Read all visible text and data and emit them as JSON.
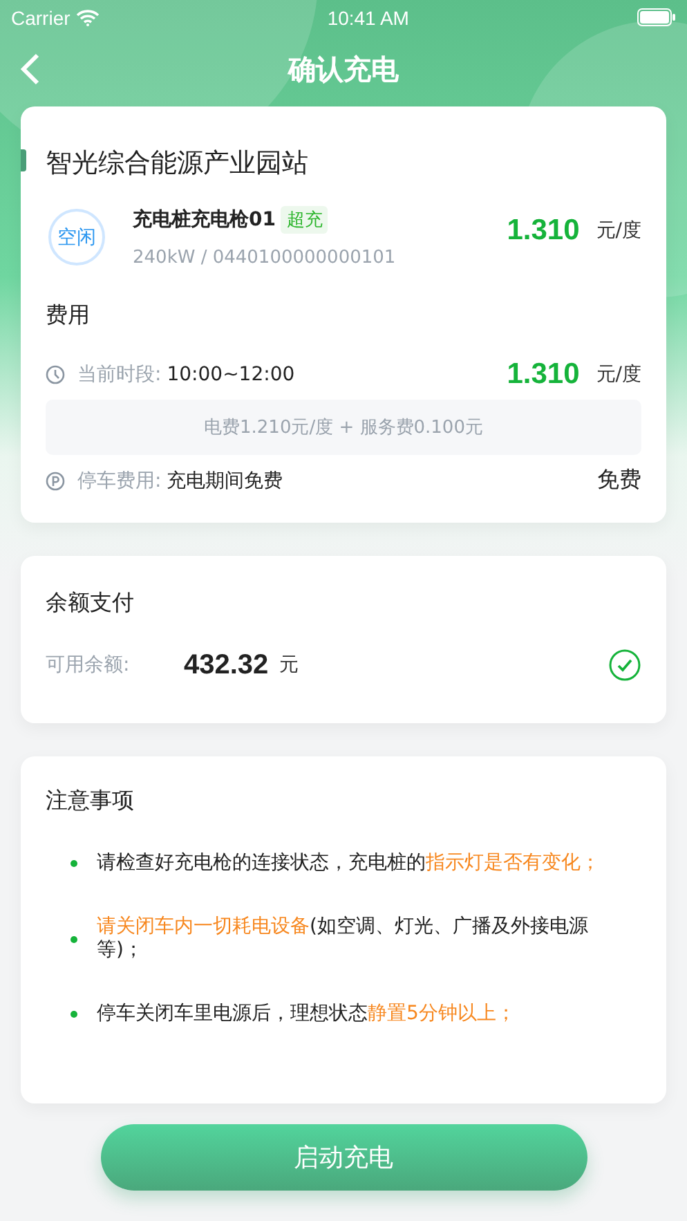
{
  "status_bar": {
    "carrier": "Carrier",
    "time": "10:41 AM"
  },
  "header": {
    "title": "确认充电"
  },
  "station": {
    "name": "智光综合能源产业园站",
    "gun": {
      "status": "空闲",
      "name": "充电桩充电枪01",
      "tag": "超充",
      "spec": "240kW / 0440100000000101",
      "price": "1.310",
      "unit": "元/度"
    }
  },
  "fees": {
    "title": "费用",
    "period_label": "当前时段:",
    "period": "10:00~12:00",
    "price": "1.310",
    "unit": "元/度",
    "breakdown": "电费1.210元/度 + 服务费0.100元",
    "parking_label": "停车费用:",
    "parking": "充电期间免费",
    "parking_value": "免费"
  },
  "payment": {
    "title": "余额支付",
    "balance_label": "可用余额:",
    "balance": "432.32",
    "unit": "元",
    "selected": true
  },
  "notes": {
    "title": "注意事项",
    "items": [
      [
        {
          "text": "请检查好充电枪的连接状态，充电桩的",
          "highlight": false
        },
        {
          "text": "指示灯是否有变化；",
          "highlight": true
        }
      ],
      [
        {
          "text": "请关闭车内一切耗电设备",
          "highlight": true
        },
        {
          "text": "(如空调、灯光、广播及外接电源等)；",
          "highlight": false
        }
      ],
      [
        {
          "text": "停车关闭车里电源后，理想状态",
          "highlight": false
        },
        {
          "text": "静置5分钟以上；",
          "highlight": true
        }
      ]
    ]
  },
  "start_button": "启动充电"
}
